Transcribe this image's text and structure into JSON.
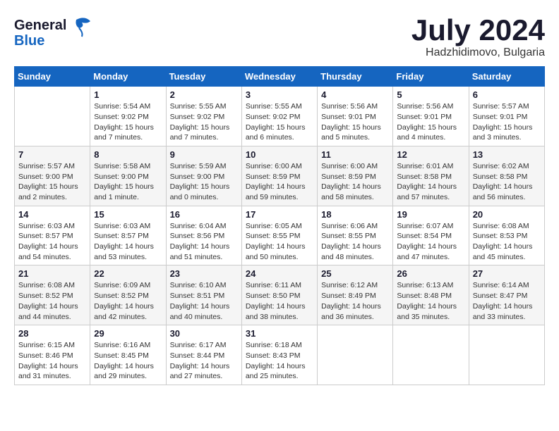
{
  "logo": {
    "line1": "General",
    "line2": "Blue"
  },
  "title": "July 2024",
  "location": "Hadzhidimovo, Bulgaria",
  "days_header": [
    "Sunday",
    "Monday",
    "Tuesday",
    "Wednesday",
    "Thursday",
    "Friday",
    "Saturday"
  ],
  "weeks": [
    [
      {
        "num": "",
        "info": ""
      },
      {
        "num": "1",
        "info": "Sunrise: 5:54 AM\nSunset: 9:02 PM\nDaylight: 15 hours\nand 7 minutes."
      },
      {
        "num": "2",
        "info": "Sunrise: 5:55 AM\nSunset: 9:02 PM\nDaylight: 15 hours\nand 7 minutes."
      },
      {
        "num": "3",
        "info": "Sunrise: 5:55 AM\nSunset: 9:02 PM\nDaylight: 15 hours\nand 6 minutes."
      },
      {
        "num": "4",
        "info": "Sunrise: 5:56 AM\nSunset: 9:01 PM\nDaylight: 15 hours\nand 5 minutes."
      },
      {
        "num": "5",
        "info": "Sunrise: 5:56 AM\nSunset: 9:01 PM\nDaylight: 15 hours\nand 4 minutes."
      },
      {
        "num": "6",
        "info": "Sunrise: 5:57 AM\nSunset: 9:01 PM\nDaylight: 15 hours\nand 3 minutes."
      }
    ],
    [
      {
        "num": "7",
        "info": "Sunrise: 5:57 AM\nSunset: 9:00 PM\nDaylight: 15 hours\nand 2 minutes."
      },
      {
        "num": "8",
        "info": "Sunrise: 5:58 AM\nSunset: 9:00 PM\nDaylight: 15 hours\nand 1 minute."
      },
      {
        "num": "9",
        "info": "Sunrise: 5:59 AM\nSunset: 9:00 PM\nDaylight: 15 hours\nand 0 minutes."
      },
      {
        "num": "10",
        "info": "Sunrise: 6:00 AM\nSunset: 8:59 PM\nDaylight: 14 hours\nand 59 minutes."
      },
      {
        "num": "11",
        "info": "Sunrise: 6:00 AM\nSunset: 8:59 PM\nDaylight: 14 hours\nand 58 minutes."
      },
      {
        "num": "12",
        "info": "Sunrise: 6:01 AM\nSunset: 8:58 PM\nDaylight: 14 hours\nand 57 minutes."
      },
      {
        "num": "13",
        "info": "Sunrise: 6:02 AM\nSunset: 8:58 PM\nDaylight: 14 hours\nand 56 minutes."
      }
    ],
    [
      {
        "num": "14",
        "info": "Sunrise: 6:03 AM\nSunset: 8:57 PM\nDaylight: 14 hours\nand 54 minutes."
      },
      {
        "num": "15",
        "info": "Sunrise: 6:03 AM\nSunset: 8:57 PM\nDaylight: 14 hours\nand 53 minutes."
      },
      {
        "num": "16",
        "info": "Sunrise: 6:04 AM\nSunset: 8:56 PM\nDaylight: 14 hours\nand 51 minutes."
      },
      {
        "num": "17",
        "info": "Sunrise: 6:05 AM\nSunset: 8:55 PM\nDaylight: 14 hours\nand 50 minutes."
      },
      {
        "num": "18",
        "info": "Sunrise: 6:06 AM\nSunset: 8:55 PM\nDaylight: 14 hours\nand 48 minutes."
      },
      {
        "num": "19",
        "info": "Sunrise: 6:07 AM\nSunset: 8:54 PM\nDaylight: 14 hours\nand 47 minutes."
      },
      {
        "num": "20",
        "info": "Sunrise: 6:08 AM\nSunset: 8:53 PM\nDaylight: 14 hours\nand 45 minutes."
      }
    ],
    [
      {
        "num": "21",
        "info": "Sunrise: 6:08 AM\nSunset: 8:52 PM\nDaylight: 14 hours\nand 44 minutes."
      },
      {
        "num": "22",
        "info": "Sunrise: 6:09 AM\nSunset: 8:52 PM\nDaylight: 14 hours\nand 42 minutes."
      },
      {
        "num": "23",
        "info": "Sunrise: 6:10 AM\nSunset: 8:51 PM\nDaylight: 14 hours\nand 40 minutes."
      },
      {
        "num": "24",
        "info": "Sunrise: 6:11 AM\nSunset: 8:50 PM\nDaylight: 14 hours\nand 38 minutes."
      },
      {
        "num": "25",
        "info": "Sunrise: 6:12 AM\nSunset: 8:49 PM\nDaylight: 14 hours\nand 36 minutes."
      },
      {
        "num": "26",
        "info": "Sunrise: 6:13 AM\nSunset: 8:48 PM\nDaylight: 14 hours\nand 35 minutes."
      },
      {
        "num": "27",
        "info": "Sunrise: 6:14 AM\nSunset: 8:47 PM\nDaylight: 14 hours\nand 33 minutes."
      }
    ],
    [
      {
        "num": "28",
        "info": "Sunrise: 6:15 AM\nSunset: 8:46 PM\nDaylight: 14 hours\nand 31 minutes."
      },
      {
        "num": "29",
        "info": "Sunrise: 6:16 AM\nSunset: 8:45 PM\nDaylight: 14 hours\nand 29 minutes."
      },
      {
        "num": "30",
        "info": "Sunrise: 6:17 AM\nSunset: 8:44 PM\nDaylight: 14 hours\nand 27 minutes."
      },
      {
        "num": "31",
        "info": "Sunrise: 6:18 AM\nSunset: 8:43 PM\nDaylight: 14 hours\nand 25 minutes."
      },
      {
        "num": "",
        "info": ""
      },
      {
        "num": "",
        "info": ""
      },
      {
        "num": "",
        "info": ""
      }
    ]
  ]
}
